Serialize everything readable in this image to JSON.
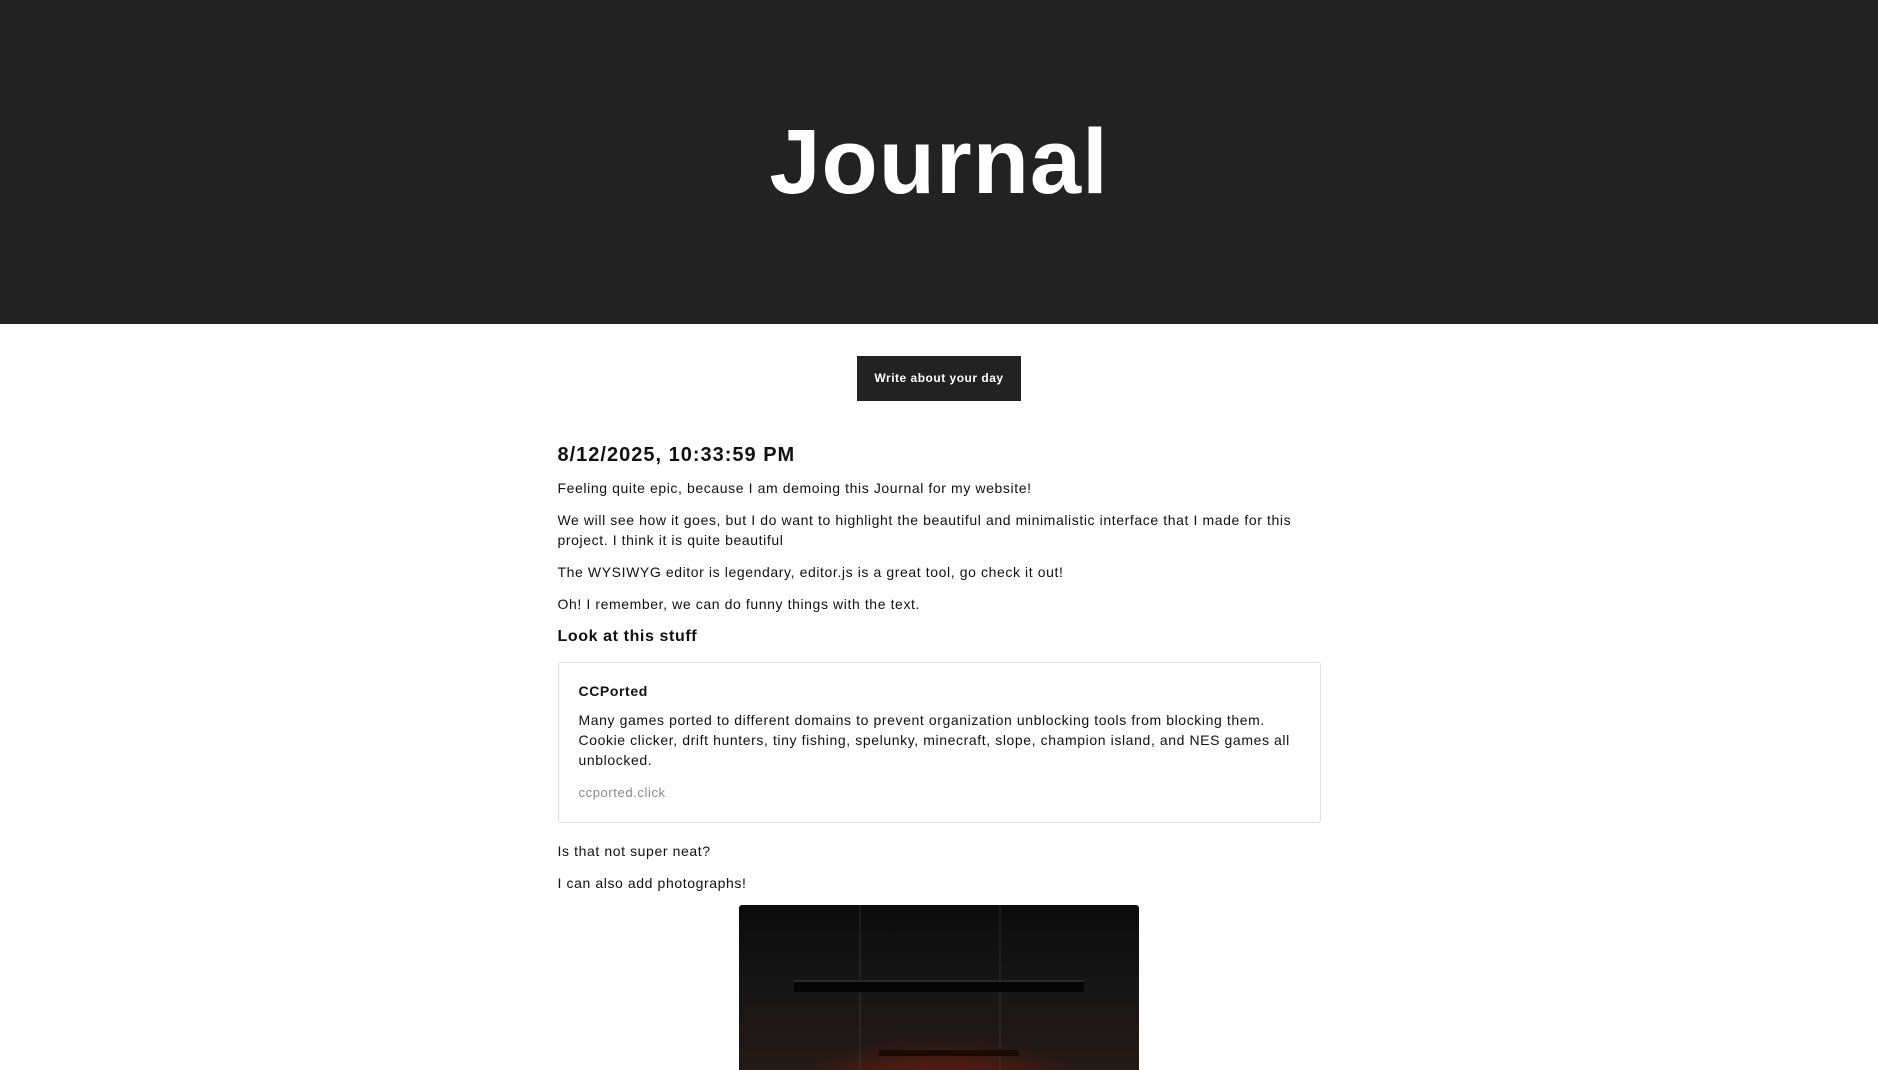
{
  "header": {
    "title": "Journal"
  },
  "actions": {
    "write_label": "Write about your day"
  },
  "entry": {
    "date": "8/12/2025, 10:33:59 PM",
    "paragraphs": [
      "Feeling quite epic, because I am demoing this Journal for my website!",
      "We will see how it goes, but I do want to highlight the beautiful and minimalistic interface that I made for this project. I think it is quite beautiful",
      "The WYSIWYG editor is legendary, editor.js is a great tool, go check it out!",
      "Oh! I remember, we can do funny things with the text."
    ],
    "heading": "Look at this stuff",
    "link_card": {
      "title": "CCPorted",
      "description": "Many games ported to different domains to prevent organization unblocking tools from blocking them. Cookie clicker, drift hunters, tiny fishing, spelunky, minecraft, slope, champion island, and NES games all unblocked.",
      "domain": "ccported.click"
    },
    "after_paragraphs": [
      "Is that not super neat?",
      "I can also add photographs!"
    ],
    "photo_icon": "photo-image"
  },
  "colors": {
    "header_bg": "#222222",
    "button_bg": "#222222",
    "card_border": "#e0e0e0",
    "muted_text": "#888888"
  }
}
